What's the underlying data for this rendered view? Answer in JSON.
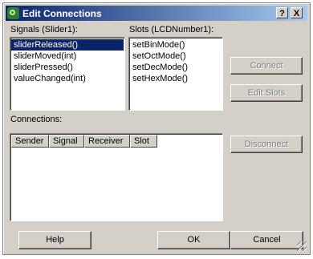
{
  "window": {
    "title": "Edit Connections",
    "help_button": "?",
    "close_button": "X"
  },
  "signals": {
    "label": "Signals (Slider1):",
    "items": [
      "sliderReleased()",
      "sliderMoved(int)",
      "sliderPressed()",
      "valueChanged(int)"
    ],
    "selected_index": 0
  },
  "slots": {
    "label": "Slots (LCDNumber1):",
    "items": [
      "setBinMode()",
      "setOctMode()",
      "setDecMode()",
      "setHexMode()"
    ]
  },
  "buttons": {
    "connect": "Connect",
    "edit_slots": "Edit Slots",
    "disconnect": "Disconnect",
    "help": "Help",
    "ok": "OK",
    "cancel": "Cancel"
  },
  "connections": {
    "label": "Connections:",
    "columns": [
      "Sender",
      "Signal",
      "Receiver",
      "Slot"
    ],
    "rows": []
  },
  "icons": {
    "app": "qt-designer-icon",
    "resize": "resize-grip-icon"
  }
}
